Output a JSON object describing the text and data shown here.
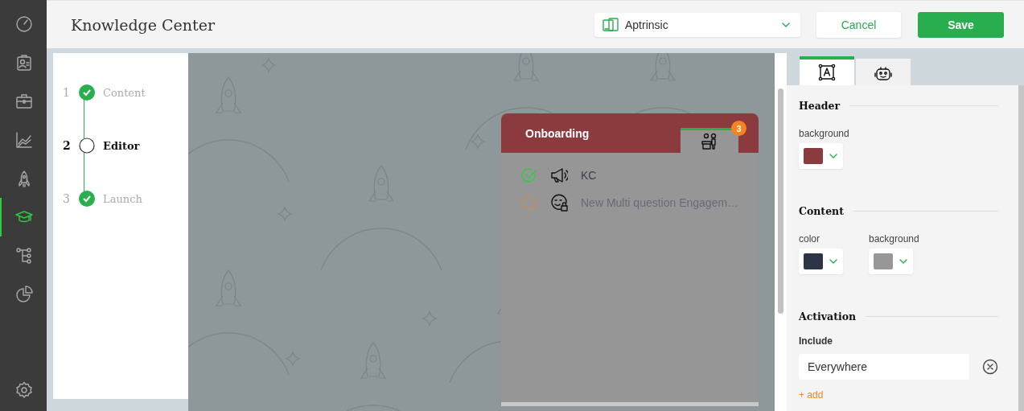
{
  "sidebar": {
    "items": [
      {
        "kind": "gauge",
        "selected": false
      },
      {
        "kind": "contact",
        "selected": false
      },
      {
        "kind": "briefcase",
        "selected": false
      },
      {
        "kind": "chart",
        "selected": false
      },
      {
        "kind": "rocket",
        "selected": false
      },
      {
        "kind": "cap",
        "selected": true
      },
      {
        "kind": "tree",
        "selected": false
      },
      {
        "kind": "pie",
        "selected": false
      }
    ],
    "bottom": {
      "kind": "settings"
    }
  },
  "header": {
    "title": "Knowledge Center",
    "app_selector": {
      "value": "Aptrinsic"
    },
    "buttons": [
      {
        "kind": "secondary",
        "label": "Cancel"
      },
      {
        "kind": "primary",
        "label": "Save"
      }
    ]
  },
  "steps": [
    {
      "number": "1",
      "label": "Content",
      "completed": true,
      "current": false
    },
    {
      "number": "2",
      "label": "Editor",
      "completed": false,
      "current": true
    },
    {
      "number": "3",
      "label": "Launch",
      "completed": true,
      "current": false
    }
  ],
  "preview": {
    "widget": {
      "title": "Onboarding",
      "tabs": [
        {
          "kind": "people",
          "badge": "3",
          "selected": true
        }
      ],
      "items": [
        {
          "kind": "announcement",
          "label": "KC",
          "completed": true
        },
        {
          "kind": "survey",
          "label": "New Multi question Engagem…",
          "completed": false
        }
      ]
    }
  },
  "panel": {
    "tabs": [
      {
        "kind": "text",
        "selected": true
      },
      {
        "kind": "bot",
        "selected": false
      }
    ],
    "sections": [
      {
        "kind": "colors",
        "title": "Header",
        "fields": [
          {
            "label": "background",
            "color": "#8b3a3d"
          }
        ]
      },
      {
        "kind": "colors",
        "title": "Content",
        "fields": [
          {
            "label": "color",
            "color": "#2d3446"
          },
          {
            "label": "background",
            "color": "#979797"
          }
        ]
      },
      {
        "kind": "activation",
        "title": "Activation",
        "label": "Include",
        "value": "Everywhere",
        "add_link": "+ add"
      }
    ]
  }
}
